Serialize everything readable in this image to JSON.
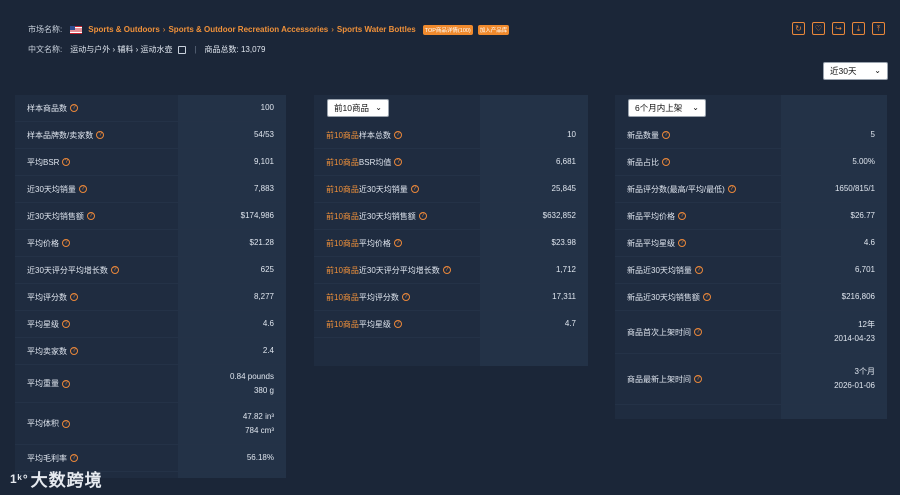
{
  "header": {
    "market_label": "市场名称:",
    "crumbs": [
      "Sports & Outdoors",
      "Sports & Outdoor Recreation Accessories",
      "Sports Water Bottles"
    ],
    "tags": [
      "TOP商品详情(100)",
      "加入产品库"
    ],
    "cn_label": "中文名称:",
    "cn_crumbs": "运动与户外 › 辅料 › 运动水壶",
    "total_label": "商品总数: 13,079"
  },
  "toolbar_icons": [
    "refresh-icon",
    "favorite-icon",
    "share-icon",
    "download-icon",
    "export-icon"
  ],
  "period_select": "近30天",
  "left_panel": {
    "rows": [
      {
        "k": "样本商品数",
        "v": "100"
      },
      {
        "k": "样本品牌数/卖家数",
        "v": "54/53"
      },
      {
        "k": "平均BSR",
        "v": "9,101"
      },
      {
        "k": "近30天均销量",
        "v": "7,883"
      },
      {
        "k": "近30天均销售额",
        "v": "$174,986"
      },
      {
        "k": "平均价格",
        "v": "$21.28"
      },
      {
        "k": "近30天评分平均增长数",
        "v": "625"
      },
      {
        "k": "平均评分数",
        "v": "8,277"
      },
      {
        "k": "平均星级",
        "v": "4.6"
      },
      {
        "k": "平均卖家数",
        "v": "2.4"
      },
      {
        "k": "平均重量",
        "v": "0.84 pounds",
        "v2": "380 g"
      },
      {
        "k": "平均体积",
        "v": "47.82 in³",
        "v2": "784 cm³"
      },
      {
        "k": "平均毛利率",
        "v": "56.18%"
      }
    ]
  },
  "mid_panel": {
    "select": "前10商品",
    "prefix": "前10商品",
    "rows": [
      {
        "k": "样本总数",
        "v": "10"
      },
      {
        "k": "BSR均值",
        "v": "6,681"
      },
      {
        "k": "近30天均销量",
        "v": "25,845"
      },
      {
        "k": "近30天均销售额",
        "v": "$632,852"
      },
      {
        "k": "平均价格",
        "v": "$23.98"
      },
      {
        "k": "近30天评分平均增长数",
        "v": "1,712"
      },
      {
        "k": "平均评分数",
        "v": "17,311"
      },
      {
        "k": "平均星级",
        "v": "4.7"
      }
    ]
  },
  "right_panel": {
    "select": "6个月内上架",
    "rows": [
      {
        "k": "新品数量",
        "v": "5"
      },
      {
        "k": "新品占比",
        "v": "5.00%"
      },
      {
        "k": "新品评分数(最高/平均/最低)",
        "v": "1650/815/1"
      },
      {
        "k": "新品平均价格",
        "v": "$26.77"
      },
      {
        "k": "新品平均星级",
        "v": "4.6"
      },
      {
        "k": "新品近30天均销量",
        "v": "6,701"
      },
      {
        "k": "新品近30天均销售额",
        "v": "$216,806"
      },
      {
        "k": "商品首次上架时间",
        "v": "12年",
        "v2": "2014-04-23"
      },
      {
        "k": "商品最新上架时间",
        "v": "3个月",
        "v2": "2026-01-06"
      }
    ]
  },
  "watermark": "大数跨境"
}
